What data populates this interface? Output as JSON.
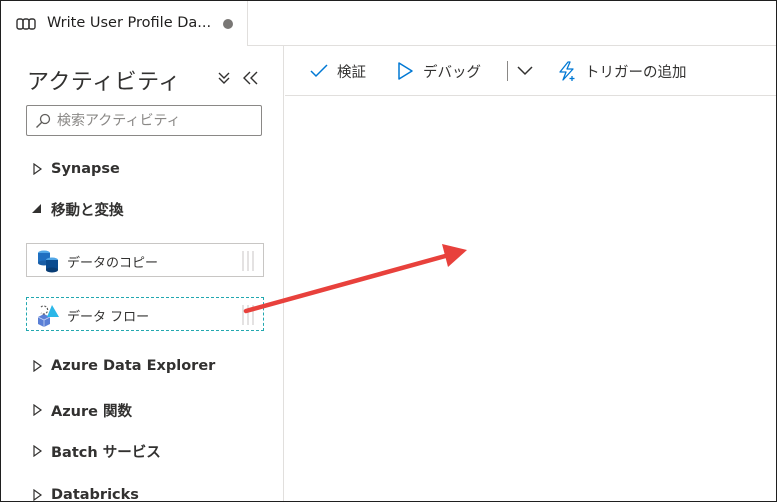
{
  "tab": {
    "title": "Write User Profile Da...",
    "icon": "pipeline-icon",
    "modified_indicator": "unsaved-dot"
  },
  "panel": {
    "title": "アクティビティ",
    "collapse_icon": "double-chevron-down-icon",
    "hide_icon": "double-chevron-left-icon",
    "search": {
      "placeholder": "検索アクティビティ",
      "value": ""
    },
    "groups": [
      {
        "label": "Synapse",
        "expanded": false
      },
      {
        "label": "移動と変換",
        "expanded": true
      },
      {
        "label": "Azure Data Explorer",
        "expanded": false
      },
      {
        "label": "Azure 関数",
        "expanded": false
      },
      {
        "label": "Batch サービス",
        "expanded": false
      },
      {
        "label": "Databricks",
        "expanded": false
      }
    ],
    "activities": [
      {
        "label": "データのコピー",
        "icon": "copy-data-icon",
        "selected": false
      },
      {
        "label": "データ フロー",
        "icon": "data-flow-icon",
        "selected": true
      }
    ]
  },
  "toolbar": {
    "validate_label": "検証",
    "debug_label": "デバッグ",
    "trigger_label": "トリガーの追加",
    "validate_icon": "checkmark-icon",
    "debug_icon": "play-icon",
    "trigger_icon": "lightning-icon",
    "more_icon": "chevron-down-icon"
  },
  "colors": {
    "accent_blue": "#0078d4",
    "arrow_red": "#e8413c",
    "selected_border": "#22a8b0"
  }
}
